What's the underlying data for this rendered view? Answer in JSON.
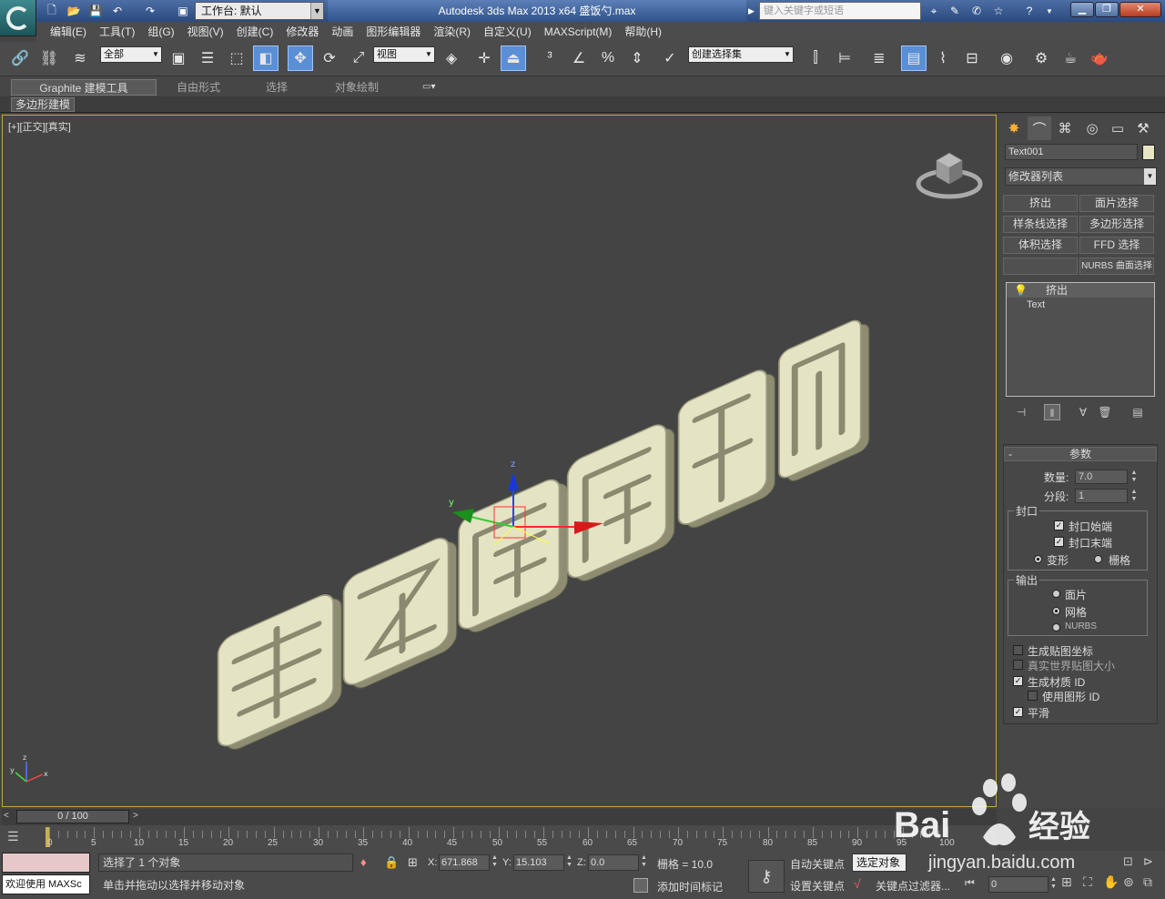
{
  "titlebar": {
    "workspace_label": "工作台: 默认",
    "title": "Autodesk 3ds Max  2013 x64      盛饭勺.max",
    "search_placeholder": "键入关键字或短语",
    "help_icon": "question-icon"
  },
  "menu": [
    "编辑(E)",
    "工具(T)",
    "组(G)",
    "视图(V)",
    "创建(C)",
    "修改器",
    "动画",
    "图形编辑器",
    "渲染(R)",
    "自定义(U)",
    "MAXScript(M)",
    "帮助(H)"
  ],
  "toolbar": {
    "filter_value": "全部",
    "refcoord_value": "视图",
    "selset_value": "创建选择集"
  },
  "ribbon": {
    "tabs": [
      "Graphite 建模工具",
      "自由形式",
      "选择",
      "对象绘制"
    ],
    "sub_label": "多边形建模"
  },
  "viewport": {
    "label": "[+][正交][真实]",
    "scene_text": "悟空厨房大厨",
    "object_color": "#e4e3c3"
  },
  "panel": {
    "object_name": "Text001",
    "object_color": "#e7e5c4",
    "modifier_list": "修改器列表",
    "buttons": [
      "挤出",
      "面片选择",
      "样条线选择",
      "多边形选择",
      "体积选择",
      "FFD 选择",
      "",
      "NURBS 曲面选择"
    ],
    "stack": [
      "挤出",
      "Text"
    ],
    "params": {
      "title": "参数",
      "amount_label": "数量:",
      "amount_value": "7.0",
      "segments_label": "分段:",
      "segments_value": "1",
      "capping_title": "封口",
      "cap_start": "封口始端",
      "cap_end": "封口末端",
      "morph": "变形",
      "grid": "栅格",
      "output_title": "输出",
      "out_patch": "面片",
      "out_mesh": "网格",
      "out_nurbs": "NURBS",
      "gen_map": "生成贴图坐标",
      "real_world": "真实世界贴图大小",
      "gen_matid": "生成材质 ID",
      "use_shape_id": "使用图形 ID",
      "smooth": "平滑"
    }
  },
  "timeline": {
    "slider_text": "0 / 100",
    "ticks": [
      "0",
      "5",
      "10",
      "15",
      "20",
      "25",
      "30",
      "35",
      "40",
      "45",
      "50",
      "55",
      "60",
      "65",
      "70",
      "75",
      "80",
      "85",
      "90",
      "95",
      "100"
    ]
  },
  "status": {
    "maxscript_label": "欢迎使用 MAXSc",
    "selected": "选择了 1 个对象",
    "prompt": "单击并拖动以选择并移动对象",
    "x_label": "X:",
    "x_value": "671.868",
    "y_label": "Y:",
    "y_value": "15.103",
    "z_label": "Z:",
    "z_value": "0.0",
    "grid": "栅格 = 10.0",
    "add_time_tag": "添加时间标记",
    "auto_key": "自动关键点",
    "selected_obj": "选定对象",
    "set_key": "设置关键点",
    "key_filter": "关键点过滤器...",
    "frame_value": "0"
  },
  "watermark": {
    "brand": "Bai",
    "brand2": "经验",
    "url": "jingyan.baidu.com"
  }
}
